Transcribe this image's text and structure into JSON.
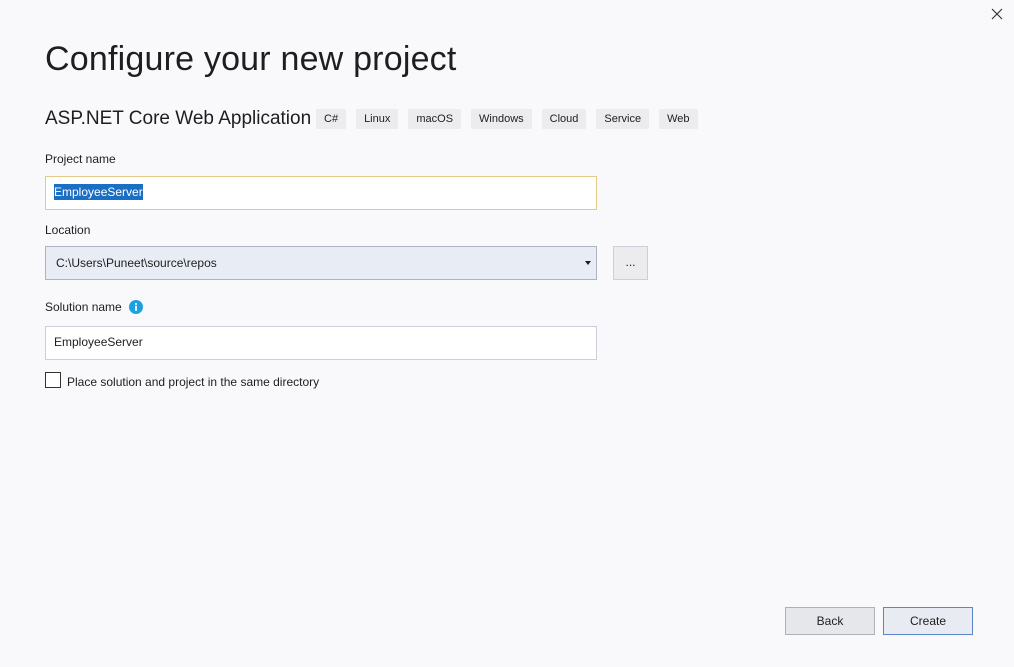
{
  "header": {
    "title": "Configure your new project",
    "template_name": "ASP.NET Core Web Application",
    "tags": [
      "C#",
      "Linux",
      "macOS",
      "Windows",
      "Cloud",
      "Service",
      "Web"
    ]
  },
  "form": {
    "project_name_label": "Project name",
    "project_name_value": "EmployeeServer",
    "location_label": "Location",
    "location_value": "C:\\Users\\Puneet\\source\\repos",
    "browse_label": "...",
    "solution_name_label": "Solution name",
    "solution_name_value": "EmployeeServer",
    "same_directory_label": "Place solution and project in the same directory",
    "same_directory_checked": false
  },
  "footer": {
    "back_label": "Back",
    "create_label": "Create"
  },
  "colors": {
    "background": "#f9f9fb",
    "selection": "#1a6fc4",
    "info_icon": "#1ba1e2",
    "focus_border": "#e3c98a"
  },
  "icons": {
    "close": "close-icon",
    "info": "info-icon",
    "dropdown": "chevron-down-icon"
  }
}
